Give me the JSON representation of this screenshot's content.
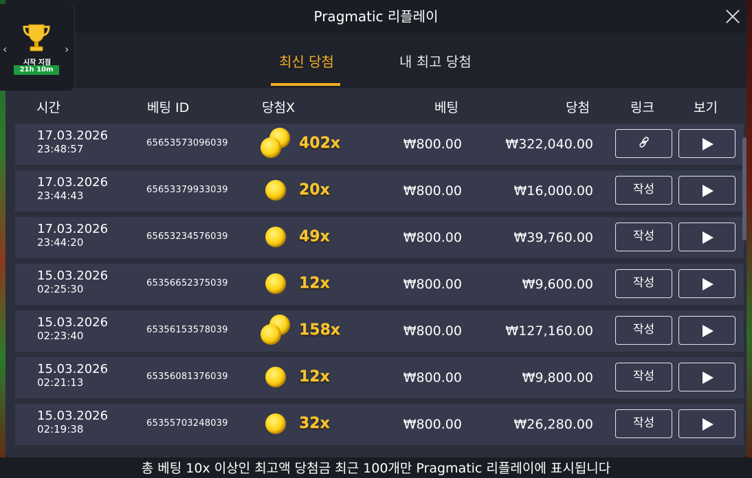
{
  "window": {
    "title": "Pragmatic 리플레이"
  },
  "tournament": {
    "label": "시작 지점",
    "timer": "21h 10m"
  },
  "tabs": [
    {
      "label": "최신 당첨",
      "active": true
    },
    {
      "label": "내 최고 당첨",
      "active": false
    }
  ],
  "columns": {
    "time": "시간",
    "bet_id": "베팅 ID",
    "multiplier": "당첨X",
    "bet": "베팅",
    "win": "당첨",
    "link": "링크",
    "view": "보기"
  },
  "rows": [
    {
      "date": "17.03.2026",
      "time": "23:48:57",
      "bet_id": "65653573096039",
      "coins": 2,
      "mult": "402x",
      "bet": "₩800.00",
      "win": "₩322,040.00",
      "link": "link-icon"
    },
    {
      "date": "17.03.2026",
      "time": "23:44:43",
      "bet_id": "65653379933039",
      "coins": 1,
      "mult": "20x",
      "bet": "₩800.00",
      "win": "₩16,000.00",
      "link": "작성"
    },
    {
      "date": "17.03.2026",
      "time": "23:44:20",
      "bet_id": "65653234576039",
      "coins": 1,
      "mult": "49x",
      "bet": "₩800.00",
      "win": "₩39,760.00",
      "link": "작성"
    },
    {
      "date": "15.03.2026",
      "time": "02:25:30",
      "bet_id": "65356652375039",
      "coins": 1,
      "mult": "12x",
      "bet": "₩800.00",
      "win": "₩9,600.00",
      "link": "작성"
    },
    {
      "date": "15.03.2026",
      "time": "02:23:40",
      "bet_id": "65356153578039",
      "coins": 2,
      "mult": "158x",
      "bet": "₩800.00",
      "win": "₩127,160.00",
      "link": "작성"
    },
    {
      "date": "15.03.2026",
      "time": "02:21:13",
      "bet_id": "65356081376039",
      "coins": 1,
      "mult": "12x",
      "bet": "₩800.00",
      "win": "₩9,800.00",
      "link": "작성"
    },
    {
      "date": "15.03.2026",
      "time": "02:19:38",
      "bet_id": "65355703248039",
      "coins": 1,
      "mult": "32x",
      "bet": "₩800.00",
      "win": "₩26,280.00",
      "link": "작성"
    }
  ],
  "footer": {
    "text": "총 베팅 10x 이상인 최고액 당첨금 최근 100개만 Pragmatic 리플레이에 표시됩니다"
  },
  "colors": {
    "accent": "#f5b01e",
    "panel": "#2b2e3b",
    "row": "#363a4c",
    "header": "#1b1d25"
  }
}
